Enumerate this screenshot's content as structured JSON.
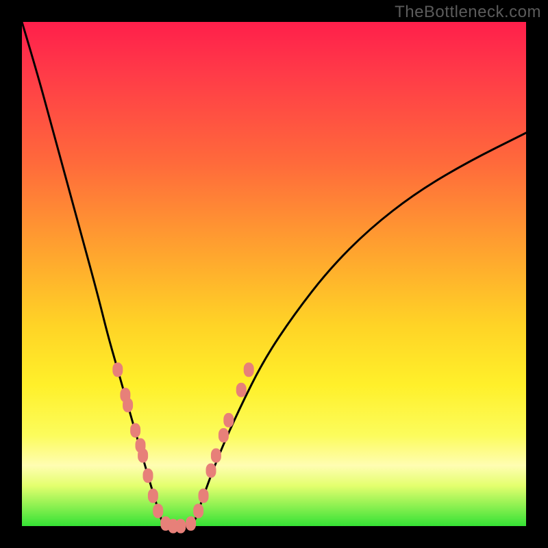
{
  "watermark": "TheBottleneck.com",
  "colors": {
    "frame": "#000000",
    "gradient_stops": [
      "#ff1f4b",
      "#ff3a48",
      "#ff6a3b",
      "#ffa22f",
      "#ffd326",
      "#fff02a",
      "#fcfc5c",
      "#fffdb2",
      "#e4ff6e",
      "#35e235"
    ],
    "curve": "#000000",
    "markers": "#e78079"
  },
  "chart_data": {
    "type": "line",
    "title": "",
    "xlabel": "",
    "ylabel": "",
    "xlim": [
      0,
      100
    ],
    "ylim": [
      0,
      100
    ],
    "note": "Axes are unlabeled; x/y are normalized 0–100 estimates from pixel positions. y=0 is the bottom (green) edge.",
    "series": [
      {
        "name": "left-branch",
        "x": [
          0,
          3,
          6,
          9,
          12,
          15,
          17,
          19,
          21,
          23,
          25,
          26.5,
          28
        ],
        "y": [
          100,
          90,
          79,
          68,
          57,
          46,
          38,
          31,
          24,
          17,
          10,
          5,
          0
        ]
      },
      {
        "name": "valley",
        "x": [
          28,
          29.5,
          31,
          32.5,
          34
        ],
        "y": [
          0,
          0,
          0,
          0,
          0
        ]
      },
      {
        "name": "right-branch",
        "x": [
          34,
          36,
          39,
          43,
          48,
          54,
          61,
          69,
          78,
          88,
          100
        ],
        "y": [
          0,
          6,
          14,
          23,
          33,
          42,
          51,
          59,
          66,
          72,
          78
        ]
      }
    ],
    "markers": {
      "name": "salmon-dots",
      "shape": "rounded-capsule",
      "note": "Clusters of salmon-colored lozenge markers along lower parts of both branches and across the valley floor.",
      "points": [
        {
          "x": 19.0,
          "y": 31.0
        },
        {
          "x": 20.5,
          "y": 26.0
        },
        {
          "x": 21.0,
          "y": 24.0
        },
        {
          "x": 22.5,
          "y": 19.0
        },
        {
          "x": 23.5,
          "y": 16.0
        },
        {
          "x": 24.0,
          "y": 14.0
        },
        {
          "x": 25.0,
          "y": 10.0
        },
        {
          "x": 26.0,
          "y": 6.0
        },
        {
          "x": 27.0,
          "y": 3.0
        },
        {
          "x": 28.5,
          "y": 0.5
        },
        {
          "x": 30.0,
          "y": 0.0
        },
        {
          "x": 31.5,
          "y": 0.0
        },
        {
          "x": 33.5,
          "y": 0.5
        },
        {
          "x": 35.0,
          "y": 3.0
        },
        {
          "x": 36.0,
          "y": 6.0
        },
        {
          "x": 37.5,
          "y": 11.0
        },
        {
          "x": 38.5,
          "y": 14.0
        },
        {
          "x": 40.0,
          "y": 18.0
        },
        {
          "x": 41.0,
          "y": 21.0
        },
        {
          "x": 43.5,
          "y": 27.0
        },
        {
          "x": 45.0,
          "y": 31.0
        }
      ]
    }
  }
}
